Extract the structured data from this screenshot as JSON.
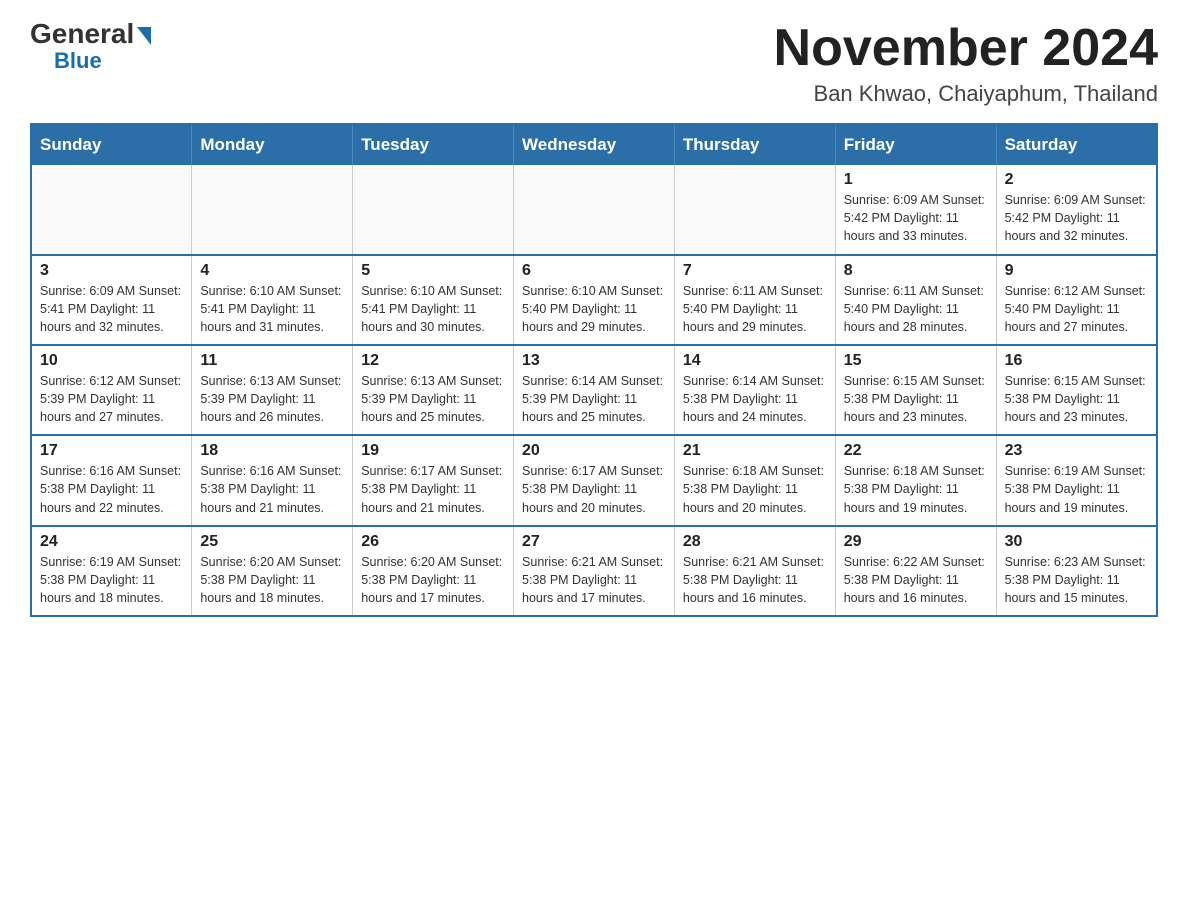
{
  "header": {
    "logo_general": "General",
    "logo_blue": "Blue",
    "month_title": "November 2024",
    "location": "Ban Khwao, Chaiyaphum, Thailand"
  },
  "calendar": {
    "days_of_week": [
      "Sunday",
      "Monday",
      "Tuesday",
      "Wednesday",
      "Thursday",
      "Friday",
      "Saturday"
    ],
    "weeks": [
      [
        {
          "day": "",
          "info": ""
        },
        {
          "day": "",
          "info": ""
        },
        {
          "day": "",
          "info": ""
        },
        {
          "day": "",
          "info": ""
        },
        {
          "day": "",
          "info": ""
        },
        {
          "day": "1",
          "info": "Sunrise: 6:09 AM\nSunset: 5:42 PM\nDaylight: 11 hours\nand 33 minutes."
        },
        {
          "day": "2",
          "info": "Sunrise: 6:09 AM\nSunset: 5:42 PM\nDaylight: 11 hours\nand 32 minutes."
        }
      ],
      [
        {
          "day": "3",
          "info": "Sunrise: 6:09 AM\nSunset: 5:41 PM\nDaylight: 11 hours\nand 32 minutes."
        },
        {
          "day": "4",
          "info": "Sunrise: 6:10 AM\nSunset: 5:41 PM\nDaylight: 11 hours\nand 31 minutes."
        },
        {
          "day": "5",
          "info": "Sunrise: 6:10 AM\nSunset: 5:41 PM\nDaylight: 11 hours\nand 30 minutes."
        },
        {
          "day": "6",
          "info": "Sunrise: 6:10 AM\nSunset: 5:40 PM\nDaylight: 11 hours\nand 29 minutes."
        },
        {
          "day": "7",
          "info": "Sunrise: 6:11 AM\nSunset: 5:40 PM\nDaylight: 11 hours\nand 29 minutes."
        },
        {
          "day": "8",
          "info": "Sunrise: 6:11 AM\nSunset: 5:40 PM\nDaylight: 11 hours\nand 28 minutes."
        },
        {
          "day": "9",
          "info": "Sunrise: 6:12 AM\nSunset: 5:40 PM\nDaylight: 11 hours\nand 27 minutes."
        }
      ],
      [
        {
          "day": "10",
          "info": "Sunrise: 6:12 AM\nSunset: 5:39 PM\nDaylight: 11 hours\nand 27 minutes."
        },
        {
          "day": "11",
          "info": "Sunrise: 6:13 AM\nSunset: 5:39 PM\nDaylight: 11 hours\nand 26 minutes."
        },
        {
          "day": "12",
          "info": "Sunrise: 6:13 AM\nSunset: 5:39 PM\nDaylight: 11 hours\nand 25 minutes."
        },
        {
          "day": "13",
          "info": "Sunrise: 6:14 AM\nSunset: 5:39 PM\nDaylight: 11 hours\nand 25 minutes."
        },
        {
          "day": "14",
          "info": "Sunrise: 6:14 AM\nSunset: 5:38 PM\nDaylight: 11 hours\nand 24 minutes."
        },
        {
          "day": "15",
          "info": "Sunrise: 6:15 AM\nSunset: 5:38 PM\nDaylight: 11 hours\nand 23 minutes."
        },
        {
          "day": "16",
          "info": "Sunrise: 6:15 AM\nSunset: 5:38 PM\nDaylight: 11 hours\nand 23 minutes."
        }
      ],
      [
        {
          "day": "17",
          "info": "Sunrise: 6:16 AM\nSunset: 5:38 PM\nDaylight: 11 hours\nand 22 minutes."
        },
        {
          "day": "18",
          "info": "Sunrise: 6:16 AM\nSunset: 5:38 PM\nDaylight: 11 hours\nand 21 minutes."
        },
        {
          "day": "19",
          "info": "Sunrise: 6:17 AM\nSunset: 5:38 PM\nDaylight: 11 hours\nand 21 minutes."
        },
        {
          "day": "20",
          "info": "Sunrise: 6:17 AM\nSunset: 5:38 PM\nDaylight: 11 hours\nand 20 minutes."
        },
        {
          "day": "21",
          "info": "Sunrise: 6:18 AM\nSunset: 5:38 PM\nDaylight: 11 hours\nand 20 minutes."
        },
        {
          "day": "22",
          "info": "Sunrise: 6:18 AM\nSunset: 5:38 PM\nDaylight: 11 hours\nand 19 minutes."
        },
        {
          "day": "23",
          "info": "Sunrise: 6:19 AM\nSunset: 5:38 PM\nDaylight: 11 hours\nand 19 minutes."
        }
      ],
      [
        {
          "day": "24",
          "info": "Sunrise: 6:19 AM\nSunset: 5:38 PM\nDaylight: 11 hours\nand 18 minutes."
        },
        {
          "day": "25",
          "info": "Sunrise: 6:20 AM\nSunset: 5:38 PM\nDaylight: 11 hours\nand 18 minutes."
        },
        {
          "day": "26",
          "info": "Sunrise: 6:20 AM\nSunset: 5:38 PM\nDaylight: 11 hours\nand 17 minutes."
        },
        {
          "day": "27",
          "info": "Sunrise: 6:21 AM\nSunset: 5:38 PM\nDaylight: 11 hours\nand 17 minutes."
        },
        {
          "day": "28",
          "info": "Sunrise: 6:21 AM\nSunset: 5:38 PM\nDaylight: 11 hours\nand 16 minutes."
        },
        {
          "day": "29",
          "info": "Sunrise: 6:22 AM\nSunset: 5:38 PM\nDaylight: 11 hours\nand 16 minutes."
        },
        {
          "day": "30",
          "info": "Sunrise: 6:23 AM\nSunset: 5:38 PM\nDaylight: 11 hours\nand 15 minutes."
        }
      ]
    ]
  }
}
